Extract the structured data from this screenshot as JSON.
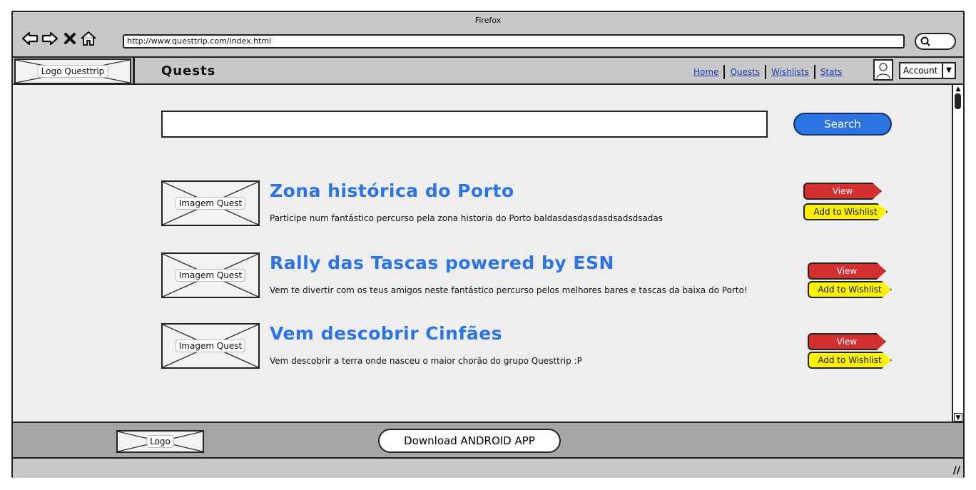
{
  "browser": {
    "title": "Firefox",
    "url": "http://www.questtrip.com/index.html"
  },
  "header": {
    "logo_label": "Logo Questtrip",
    "page_title": "Quests",
    "nav": [
      "Home",
      "Quests",
      "Wishlists",
      "Stats"
    ],
    "account_label": "Account"
  },
  "search": {
    "placeholder": "",
    "button_label": "Search"
  },
  "quests": [
    {
      "image_label": "Imagem Quest",
      "title": "Zona histórica do Porto",
      "description": "Participe num fantástico percurso pela zona historia do Porto baldasdasdasdasdsadsdsadas",
      "view_label": "View",
      "wishlist_label": "Add to Wishlist"
    },
    {
      "image_label": "Imagem Quest",
      "title": "Rally das Tascas powered by ESN",
      "description": "Vem te divertir com os teus amigos neste fantástico percurso pelos melhores bares e tascas da baixa do Porto!",
      "view_label": "View",
      "wishlist_label": "Add to Wishlist"
    },
    {
      "image_label": "Imagem Quest",
      "title": "Vem descobrir Cinfães",
      "description": "Vem descobrir a terra onde nasceu o maior chorão do grupo Questtrip :P",
      "view_label": "View",
      "wishlist_label": "Add to Wishlist"
    }
  ],
  "footer": {
    "logo_label": "Logo",
    "android_button": "Download ANDROID APP"
  },
  "colors": {
    "accent_blue": "#2b74e1",
    "view_red": "#d32f2f",
    "wishlist_yellow": "#fff200"
  }
}
